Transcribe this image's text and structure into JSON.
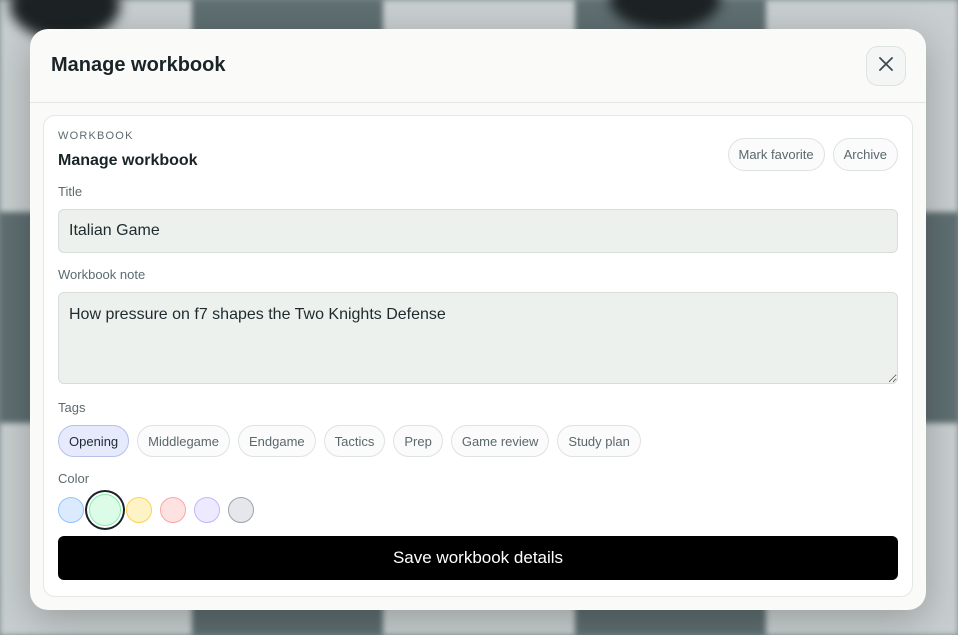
{
  "modal": {
    "title": "Manage workbook",
    "close_icon": "close-icon"
  },
  "card": {
    "eyebrow": "WORKBOOK",
    "title": "Manage workbook",
    "actions": {
      "favorite_label": "Mark favorite",
      "archive_label": "Archive"
    }
  },
  "title_field": {
    "label": "Title",
    "value": "Italian Game"
  },
  "note_field": {
    "label": "Workbook note",
    "value": "How pressure on f7 shapes the Two Knights Defense"
  },
  "tags": {
    "label": "Tags",
    "items": [
      "Opening",
      "Middlegame",
      "Endgame",
      "Tactics",
      "Prep",
      "Game review",
      "Study plan"
    ],
    "selected": "Opening"
  },
  "color": {
    "label": "Color",
    "swatches": [
      {
        "name": "blue",
        "fill": "#dbeafe",
        "border": "#93c5fd"
      },
      {
        "name": "green",
        "fill": "#dcfce7",
        "border": "#86efac"
      },
      {
        "name": "yellow",
        "fill": "#fef3c7",
        "border": "#fcd34d"
      },
      {
        "name": "red",
        "fill": "#fee2e2",
        "border": "#fca5a5"
      },
      {
        "name": "purple",
        "fill": "#ede9fe",
        "border": "#c4b5fd"
      },
      {
        "name": "gray",
        "fill": "#e5e7eb",
        "border": "#9ca3af"
      }
    ],
    "selected": "green"
  },
  "save_button_label": "Save workbook details"
}
